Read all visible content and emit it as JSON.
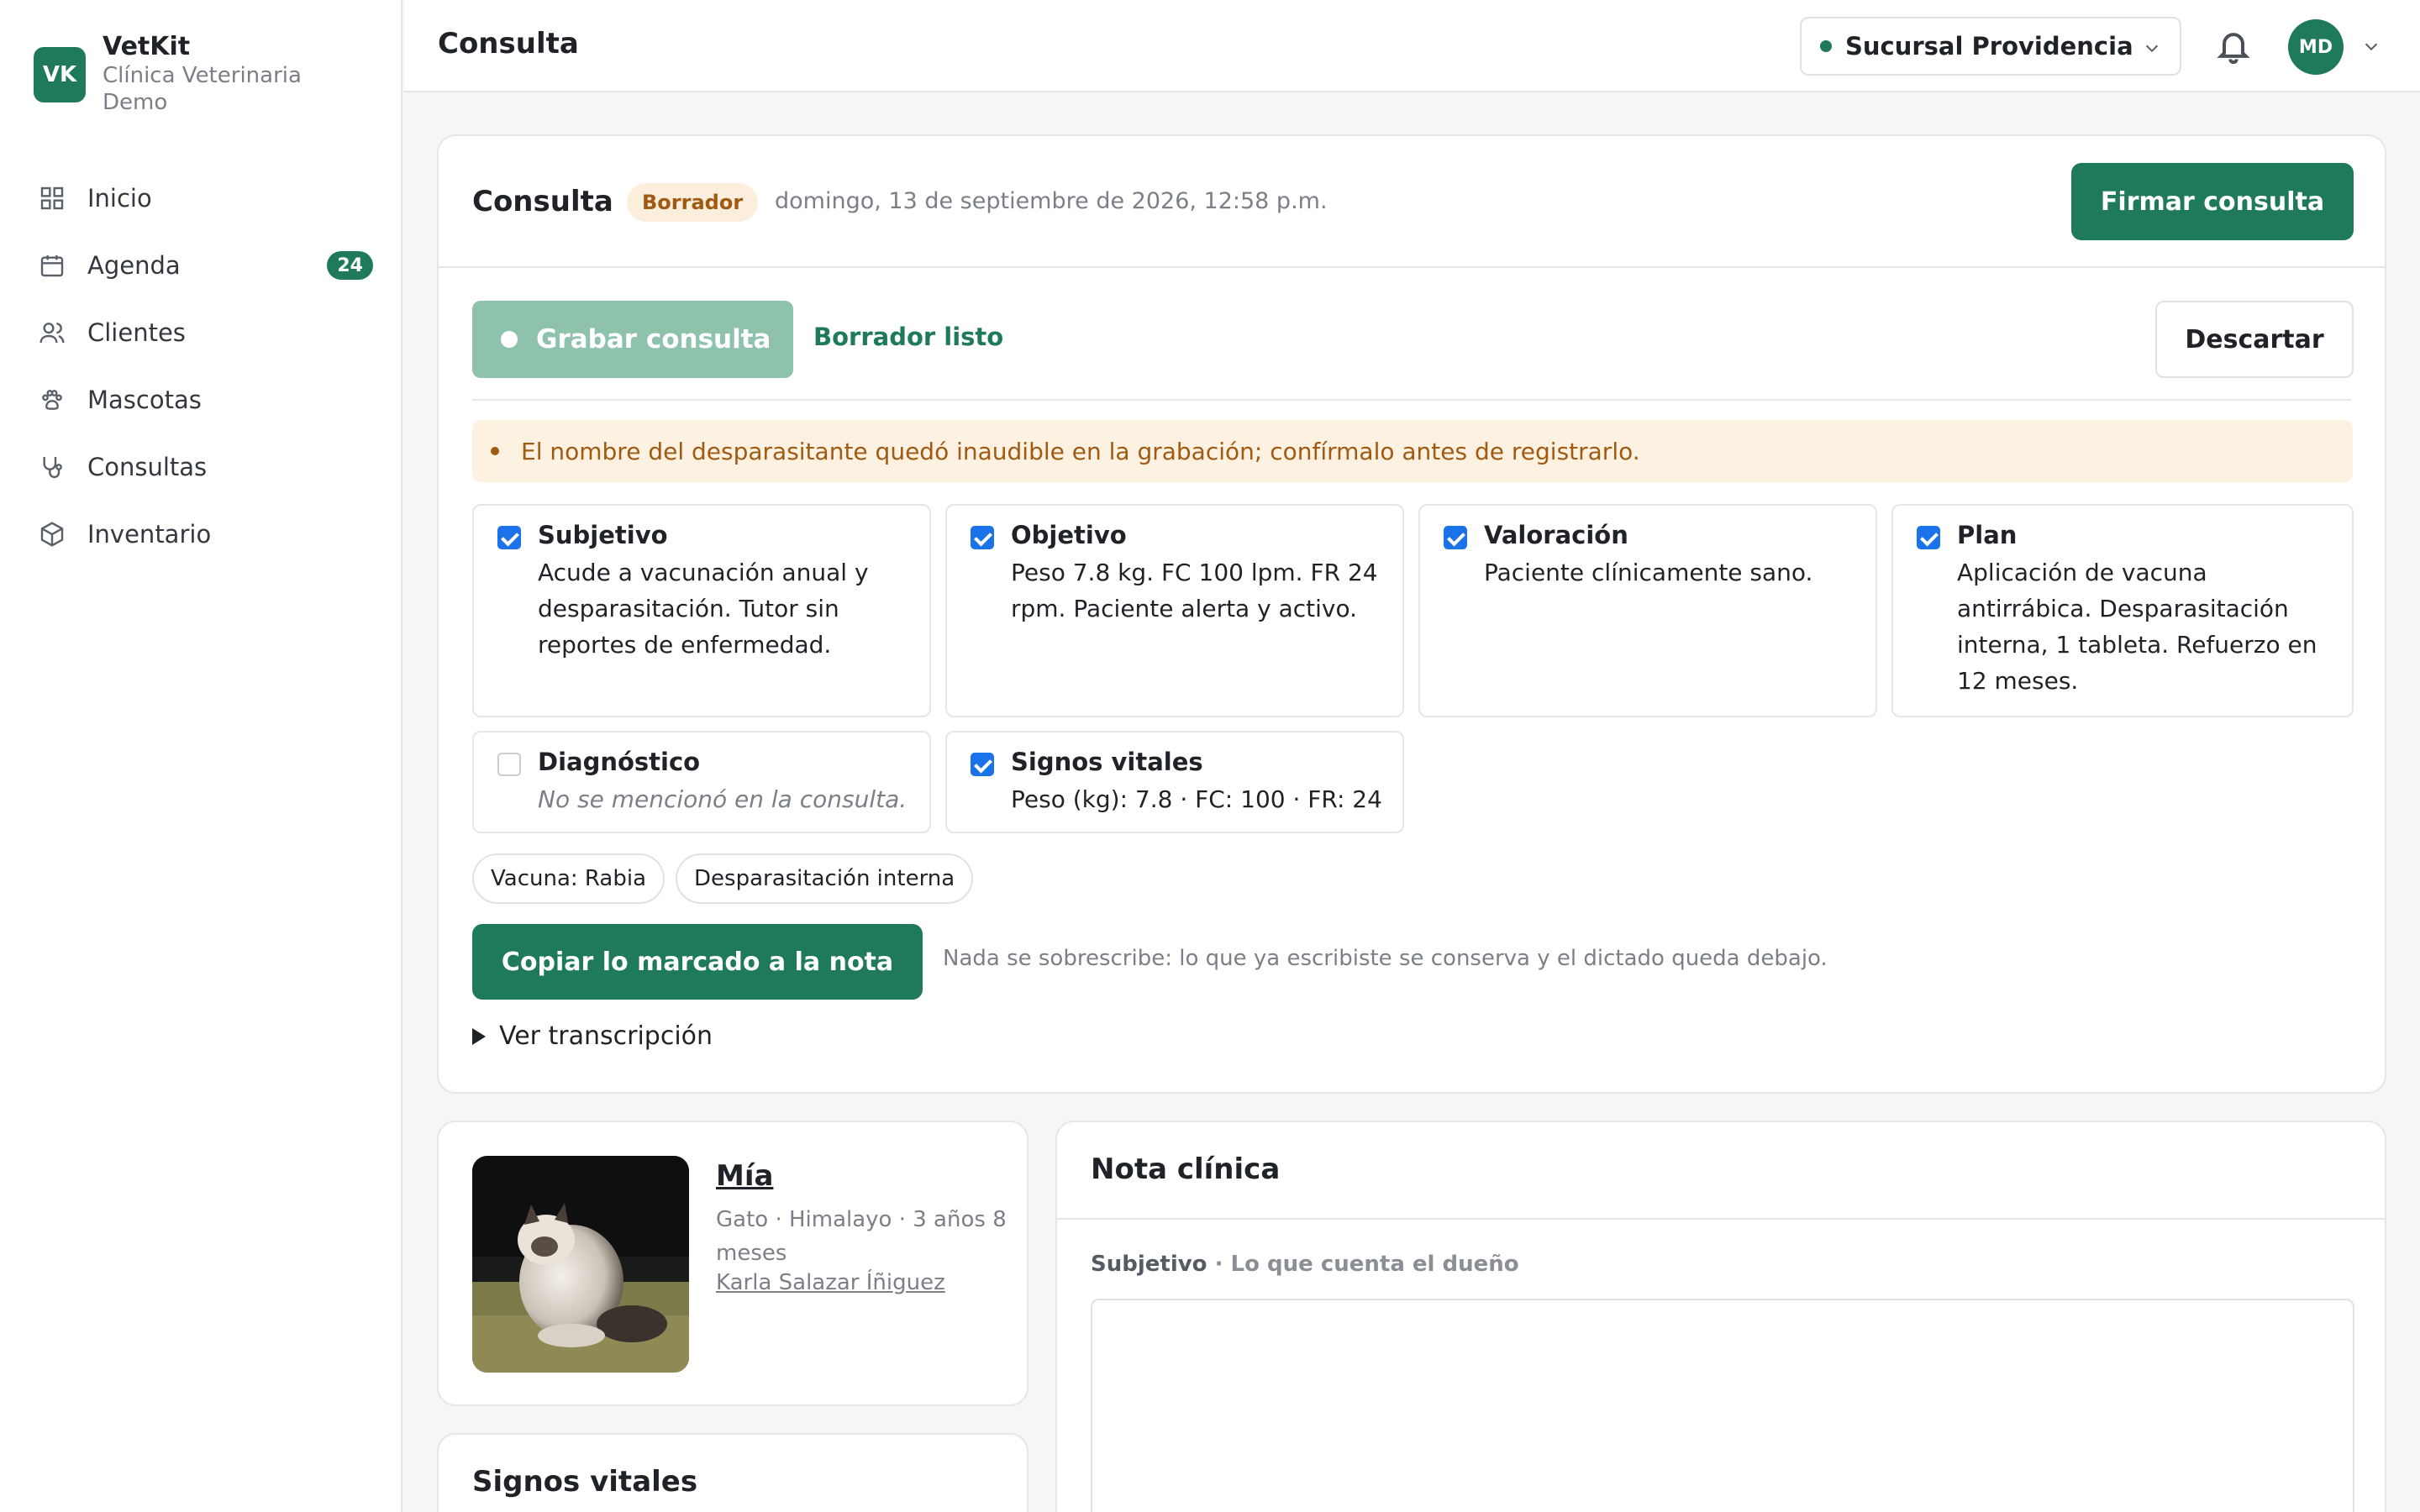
{
  "brand": {
    "logo": "VK",
    "name": "VetKit",
    "subtitle": "Clínica Veterinaria Demo"
  },
  "sidebar": {
    "items": [
      {
        "label": "Inicio",
        "icon": "grid-icon"
      },
      {
        "label": "Agenda",
        "icon": "calendar-icon",
        "badge": "24"
      },
      {
        "label": "Clientes",
        "icon": "users-icon"
      },
      {
        "label": "Mascotas",
        "icon": "paw-icon"
      },
      {
        "label": "Consultas",
        "icon": "stethoscope-icon"
      },
      {
        "label": "Inventario",
        "icon": "box-icon"
      }
    ]
  },
  "header": {
    "title": "Consulta",
    "branch": "Sucursal Providencia",
    "avatar": "MD"
  },
  "consulta": {
    "title": "Consulta",
    "status": "Borrador",
    "date": "domingo, 13 de septiembre de 2026, 12:58 p.m.",
    "sign_button": "Firmar consulta",
    "record_button": "Grabar consulta",
    "draft_ready": "Borrador listo",
    "discard_button": "Descartar",
    "warning": "El nombre del desparasitante quedó inaudible en la grabación; confírmalo antes de registrarlo.",
    "sections": [
      {
        "title": "Subjetivo",
        "body": "Acude a vacunación anual y desparasitación. Tutor sin reportes de enfermedad.",
        "checked": true
      },
      {
        "title": "Objetivo",
        "body": "Peso 7.8 kg. FC 100 lpm. FR 24 rpm. Paciente alerta y activo.",
        "checked": true
      },
      {
        "title": "Valoración",
        "body": "Paciente clínicamente sano.",
        "checked": true
      },
      {
        "title": "Plan",
        "body": "Aplicación de vacuna antirrábica. Desparasitación interna, 1 tableta. Refuerzo en 12 meses.",
        "checked": true
      },
      {
        "title": "Diagnóstico",
        "body": "No se mencionó en la consulta.",
        "checked": false
      },
      {
        "title": "Signos vitales",
        "body": "Peso (kg): 7.8 · FC: 100 · FR: 24",
        "checked": true
      }
    ],
    "tags": [
      "Vacuna: Rabia",
      "Desparasitación interna"
    ],
    "copy_button": "Copiar lo marcado a la nota",
    "copy_hint": "Nada se sobrescribe: lo que ya escribiste se conserva y el dictado queda debajo.",
    "transcript_toggle": "Ver transcripción"
  },
  "pet": {
    "name": "Mía",
    "meta": "Gato · Himalayo · 3 años 8 meses",
    "owner": "Karla Salazar Íñiguez"
  },
  "vitals": {
    "title": "Signos vitales"
  },
  "nota": {
    "title": "Nota clínica",
    "field_label": "Subjetivo",
    "field_hint": "· Lo que cuenta el dueño",
    "field_value": ""
  },
  "colors": {
    "accent": "#1f7a5c",
    "warning_bg": "#fdf1e2",
    "warning_text": "#a05a12",
    "checkbox": "#1a73e8"
  }
}
